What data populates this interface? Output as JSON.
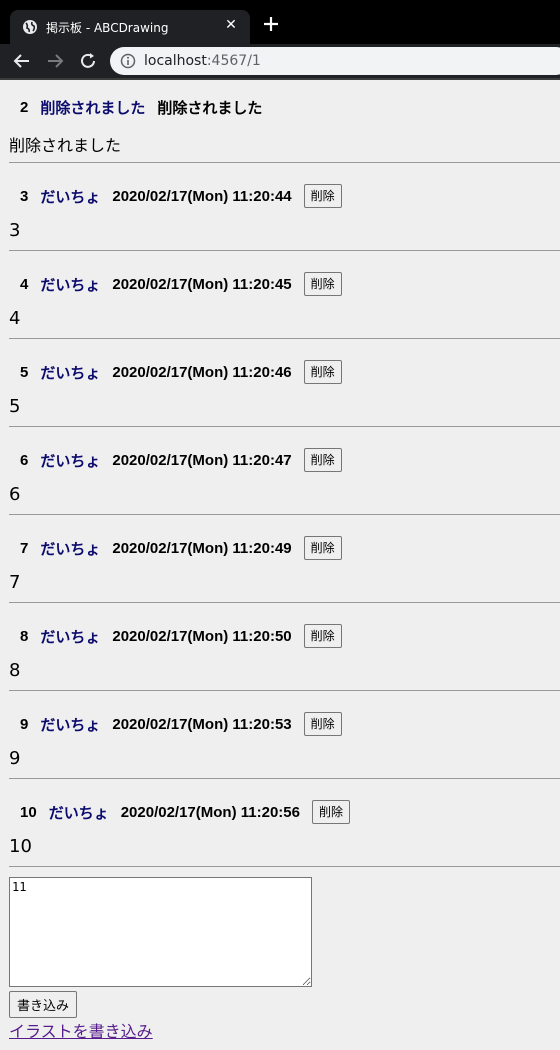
{
  "browser": {
    "tab_title": "掲示板 - ABCDrawing",
    "url_host": "localhost",
    "url_rest": ":4567/1"
  },
  "posts": [
    {
      "num": "2",
      "name": "削除されました",
      "date": "削除されました",
      "body": "削除されました",
      "deleted": true
    },
    {
      "num": "3",
      "name": "だいちょ",
      "date": "2020/02/17(Mon) 11:20:44",
      "body": "3",
      "delete_label": "削除"
    },
    {
      "num": "4",
      "name": "だいちょ",
      "date": "2020/02/17(Mon) 11:20:45",
      "body": "4",
      "delete_label": "削除"
    },
    {
      "num": "5",
      "name": "だいちょ",
      "date": "2020/02/17(Mon) 11:20:46",
      "body": "5",
      "delete_label": "削除"
    },
    {
      "num": "6",
      "name": "だいちょ",
      "date": "2020/02/17(Mon) 11:20:47",
      "body": "6",
      "delete_label": "削除"
    },
    {
      "num": "7",
      "name": "だいちょ",
      "date": "2020/02/17(Mon) 11:20:49",
      "body": "7",
      "delete_label": "削除"
    },
    {
      "num": "8",
      "name": "だいちょ",
      "date": "2020/02/17(Mon) 11:20:50",
      "body": "8",
      "delete_label": "削除"
    },
    {
      "num": "9",
      "name": "だいちょ",
      "date": "2020/02/17(Mon) 11:20:53",
      "body": "9",
      "delete_label": "削除"
    },
    {
      "num": "10",
      "name": "だいちょ",
      "date": "2020/02/17(Mon) 11:20:56",
      "body": "10",
      "delete_label": "削除"
    }
  ],
  "form": {
    "textarea_value": "11",
    "submit_label": "書き込み",
    "draw_link": "イラストを書き込み"
  }
}
